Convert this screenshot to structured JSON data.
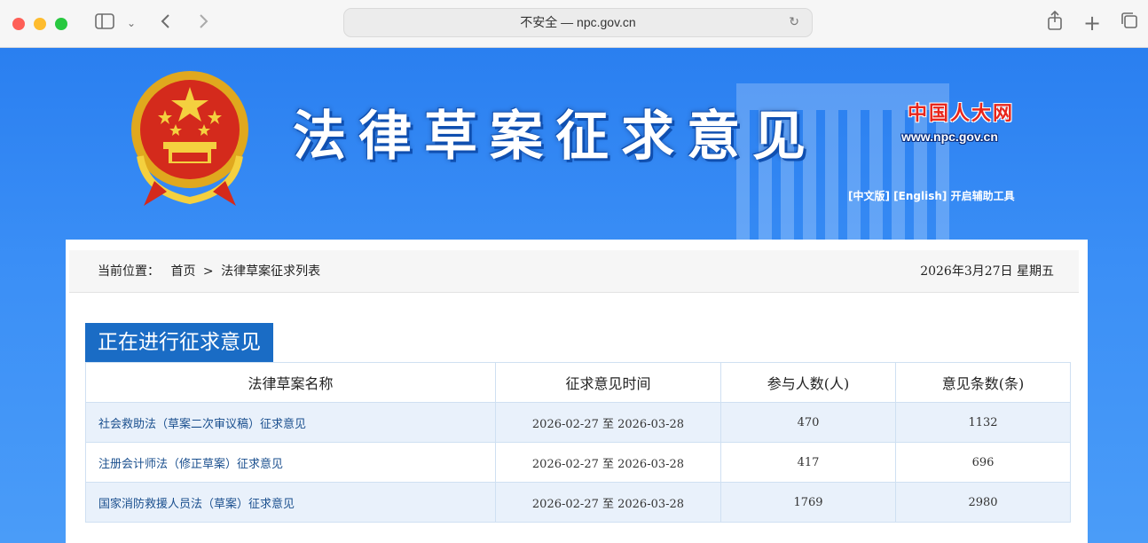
{
  "browser": {
    "url": "不安全 — npc.gov.cn"
  },
  "header": {
    "title": "法律草案征求意见",
    "site_name": "中国人大网",
    "site_url": "www.npc.gov.cn",
    "lang_cn": "[中文版]",
    "lang_en": "[English]",
    "accessibility": "开启辅助工具"
  },
  "breadcrumb": {
    "prefix": "当前位置：",
    "home": "首页",
    "separator": ">",
    "current": "法律草案征求列表"
  },
  "date": "2026年3月27日 星期五",
  "section": {
    "title": "正在进行征求意见"
  },
  "table": {
    "headers": [
      "法律草案名称",
      "征求意见时间",
      "参与人数(人)",
      "意见条数(条)"
    ],
    "rows": [
      {
        "name": "社会救助法（草案二次审议稿）征求意见",
        "period": "2026-02-27 至 2026-03-28",
        "participants": "470",
        "comments": "1132"
      },
      {
        "name": "注册会计师法（修正草案）征求意见",
        "period": "2026-02-27 至 2026-03-28",
        "participants": "417",
        "comments": "696"
      },
      {
        "name": "国家消防救援人员法（草案）征求意见",
        "period": "2026-02-27 至 2026-03-28",
        "participants": "1769",
        "comments": "2980"
      }
    ]
  }
}
